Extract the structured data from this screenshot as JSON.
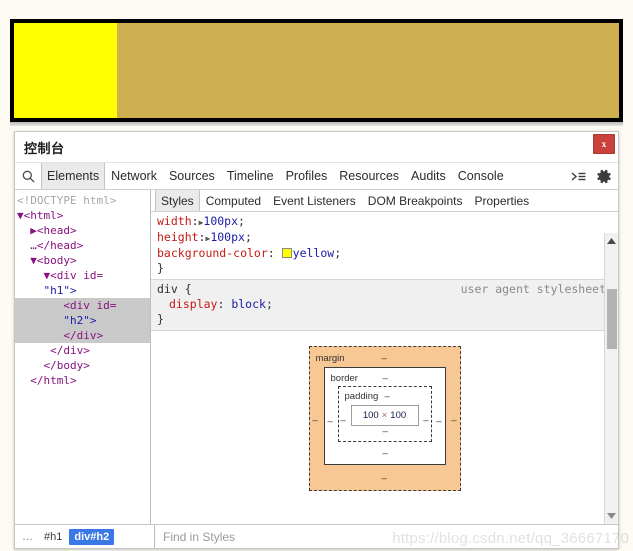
{
  "preview": {
    "outer_color": "#cfb051",
    "inner_box_color": "#ffff00",
    "border_color": "#000000"
  },
  "devtools": {
    "title": "控制台",
    "close_label": "x",
    "search_icon": "search-icon",
    "tabs": [
      {
        "label": "Elements",
        "active": true
      },
      {
        "label": "Network",
        "active": false
      },
      {
        "label": "Sources",
        "active": false
      },
      {
        "label": "Timeline",
        "active": false
      },
      {
        "label": "Profiles",
        "active": false
      },
      {
        "label": "Resources",
        "active": false
      },
      {
        "label": "Audits",
        "active": false
      },
      {
        "label": "Console",
        "active": false
      }
    ],
    "toolbar_icons": [
      {
        "name": "console-drawer-icon",
        "glyph": "⌫"
      },
      {
        "name": "settings-gear-icon",
        "glyph": "⚙"
      }
    ]
  },
  "dom_tree": [
    {
      "text": "<!DOCTYPE html>",
      "kind": "doctype",
      "selected": false
    },
    {
      "text": "▼<html>",
      "kind": "tag",
      "selected": false
    },
    {
      "text": "  ▶<head>",
      "kind": "tag",
      "selected": false
    },
    {
      "text": "  …</head>",
      "kind": "tag",
      "selected": false
    },
    {
      "text": "  ▼<body>",
      "kind": "tag",
      "selected": false
    },
    {
      "text": "    ▼<div id=",
      "kind": "tag",
      "selected": false
    },
    {
      "text": "    \"h1\">",
      "kind": "attr",
      "selected": false
    },
    {
      "text": "       <div id=",
      "kind": "tag",
      "selected": true
    },
    {
      "text": "       \"h2\">",
      "kind": "attr",
      "selected": true
    },
    {
      "text": "       </div>",
      "kind": "tag",
      "selected": true
    },
    {
      "text": "     </div>",
      "kind": "tag",
      "selected": false
    },
    {
      "text": "    </body>",
      "kind": "tag",
      "selected": false
    },
    {
      "text": "  </html>",
      "kind": "tag",
      "selected": false
    }
  ],
  "styles": {
    "tabs": [
      {
        "label": "Styles",
        "active": true
      },
      {
        "label": "Computed",
        "active": false
      },
      {
        "label": "Event Listeners",
        "active": false
      },
      {
        "label": "DOM Breakpoints",
        "active": false
      },
      {
        "label": "Properties",
        "active": false
      }
    ],
    "rules": [
      {
        "origin": "",
        "declarations": [
          {
            "property": "width",
            "value": "100px",
            "has_arrow": true,
            "swatch": null
          },
          {
            "property": "height",
            "value": "100px",
            "has_arrow": true,
            "swatch": null
          },
          {
            "property": "background-color",
            "value": "yellow",
            "has_arrow": false,
            "swatch": "#ffff00"
          }
        ],
        "close_brace": "}"
      },
      {
        "selector": "div {",
        "origin": "user agent stylesheet",
        "declarations": [
          {
            "property": "display",
            "value": "block",
            "has_arrow": false,
            "swatch": null
          }
        ],
        "close_brace": "}"
      }
    ],
    "scrollbar": {
      "up_arrow": "▲",
      "down_arrow": "▼"
    }
  },
  "box_model": {
    "margin_label": "margin",
    "border_label": "border",
    "padding_label": "padding",
    "content_width": "100",
    "content_separator": "×",
    "content_height": "100",
    "margin_top": "–",
    "margin_right": "–",
    "margin_bottom": "–",
    "margin_left": "–",
    "border_top": "–",
    "border_right": "–",
    "border_bottom": "–",
    "border_left": "–",
    "padding_top": "–",
    "padding_right": "–",
    "padding_bottom": "–",
    "padding_left": "–",
    "margin_color": "#f7c894"
  },
  "status_bar": {
    "crumbs": [
      {
        "label": "…",
        "selected": false,
        "ellipsis": true
      },
      {
        "label": "#h1",
        "selected": false,
        "ellipsis": false
      },
      {
        "label": "div#h2",
        "selected": true,
        "ellipsis": false
      }
    ],
    "find_placeholder": "Find in Styles"
  },
  "watermark": "https://blog.csdn.net/qq_36667170"
}
